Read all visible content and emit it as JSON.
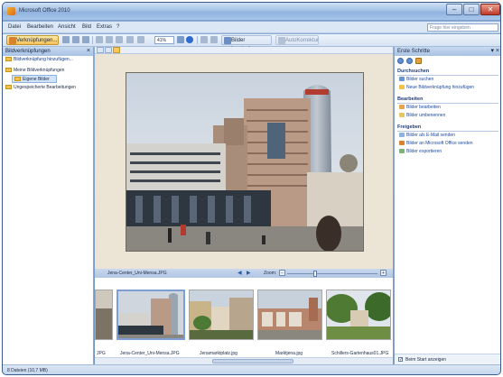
{
  "window": {
    "title": "Microsoft Office 2010"
  },
  "menu": {
    "items": [
      "Datei",
      "Bearbeiten",
      "Ansicht",
      "Bild",
      "Extras",
      "?"
    ],
    "help_placeholder": "Frage hier eingeben"
  },
  "toolbar": {
    "shortcuts_label": "Verknüpfungen...",
    "zoom_value": "41%",
    "edit_pictures_label": "Bilder bearbeiten...",
    "autocorrect_label": "AutoKorrektur"
  },
  "left_pane": {
    "title": "Bildverknüpfungen",
    "add_link": "Bildverknüpfung hinzufügen...",
    "tree": [
      {
        "label": "Meine Bildverknüpfungen",
        "level": 0,
        "selected": false
      },
      {
        "label": "Eigene Bilder",
        "level": 1,
        "selected": true
      },
      {
        "label": "Ungespeicherte Bearbeitungen",
        "level": 0,
        "selected": false
      }
    ],
    "status": "8 Dateien (10,7 MB)"
  },
  "viewer": {
    "filename": "Jena-Center_Uni-Mensa.JPG",
    "zoom_label": "Zoom:",
    "zoom_level": 0.3
  },
  "filmstrip": {
    "thumbnails": [
      {
        "label": ""
      },
      {
        "label": "Jena-Center_Uni-Mensa.JPG"
      },
      {
        "label": "Jenamarktplatz.jpg"
      },
      {
        "label": "Marktjena.jpg"
      },
      {
        "label": "Schillers-Gartenhaus01.JPG"
      }
    ],
    "partial_left_label": "JPG"
  },
  "right_pane": {
    "title": "Erste Schritte",
    "sections": [
      {
        "heading": "Durchsuchen",
        "tasks": [
          "Bilder suchen",
          "Neue Bildverknüpfung hinzufügen"
        ]
      },
      {
        "heading": "Bearbeiten",
        "tasks": [
          "Bilder bearbeiten",
          "Bilder umbenennen"
        ]
      },
      {
        "heading": "Freigeben",
        "tasks": [
          "Bilder als E-Mail senden",
          "Bilder an Microsoft Office senden",
          "Bilder exportieren"
        ]
      }
    ],
    "show_at_start": "Beim Start anzeigen"
  },
  "colors": {
    "accent": "#f6c15a",
    "link": "#1b4aa0",
    "pane_header": "#a8c2e4"
  }
}
